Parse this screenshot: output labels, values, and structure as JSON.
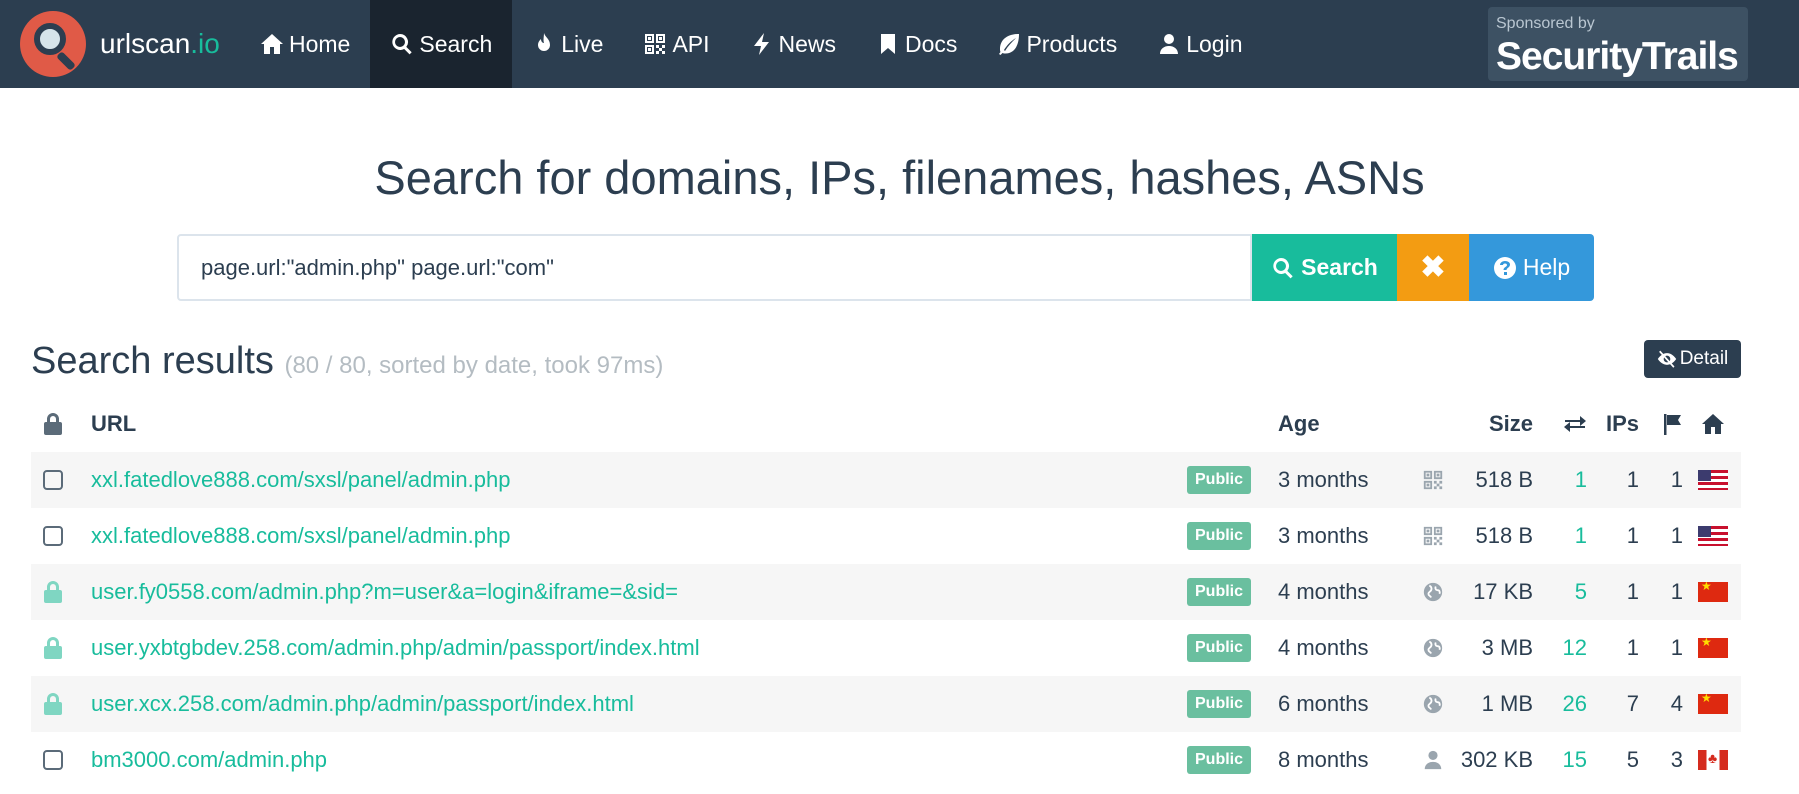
{
  "brand": {
    "name": "urlscan",
    "tld": ".io"
  },
  "nav": {
    "items": [
      {
        "label": "Home",
        "icon": "home-icon"
      },
      {
        "label": "Search",
        "icon": "search-icon",
        "active": true
      },
      {
        "label": "Live",
        "icon": "fire-icon"
      },
      {
        "label": "API",
        "icon": "qrcode-icon"
      },
      {
        "label": "News",
        "icon": "bolt-icon"
      },
      {
        "label": "Docs",
        "icon": "bookmark-icon"
      },
      {
        "label": "Products",
        "icon": "leaf-icon"
      },
      {
        "label": "Login",
        "icon": "user-icon"
      }
    ]
  },
  "sponsor": {
    "small": "Sponsored by",
    "name": "SecurityTrails"
  },
  "headline": "Search for domains, IPs, filenames, hashes, ASNs",
  "search": {
    "value": "page.url:\"admin.php\" page.url:\"com\"",
    "search_label": "Search",
    "clear_label": "✖",
    "help_label": "Help"
  },
  "results": {
    "title": "Search results",
    "meta": "(80 / 80, sorted by date, took 97ms)",
    "detail_label": "Detail"
  },
  "table": {
    "headers": {
      "url": "URL",
      "age": "Age",
      "size": "Size",
      "ips": "IPs"
    },
    "rows": [
      {
        "secure": false,
        "url": "xxl.fatedlove888.com/sxsl/panel/admin.php",
        "visibility": "Public",
        "age": "3 months",
        "source_icon": "qrcode-icon",
        "size": "518 B",
        "requests": "1",
        "ips": "1",
        "countries": "1",
        "flag": "us"
      },
      {
        "secure": false,
        "url": "xxl.fatedlove888.com/sxsl/panel/admin.php",
        "visibility": "Public",
        "age": "3 months",
        "source_icon": "qrcode-icon",
        "size": "518 B",
        "requests": "1",
        "ips": "1",
        "countries": "1",
        "flag": "us"
      },
      {
        "secure": true,
        "url": "user.fy0558.com/admin.php?m=user&a=login&iframe=&sid=",
        "visibility": "Public",
        "age": "4 months",
        "source_icon": "globe-icon",
        "size": "17 KB",
        "requests": "5",
        "ips": "1",
        "countries": "1",
        "flag": "cn"
      },
      {
        "secure": true,
        "url": "user.yxbtgbdev.258.com/admin.php/admin/passport/index.html",
        "visibility": "Public",
        "age": "4 months",
        "source_icon": "globe-icon",
        "size": "3 MB",
        "requests": "12",
        "ips": "1",
        "countries": "1",
        "flag": "cn"
      },
      {
        "secure": true,
        "url": "user.xcx.258.com/admin.php/admin/passport/index.html",
        "visibility": "Public",
        "age": "6 months",
        "source_icon": "globe-icon",
        "size": "1 MB",
        "requests": "26",
        "ips": "7",
        "countries": "4",
        "flag": "cn"
      },
      {
        "secure": false,
        "url": "bm3000.com/admin.php",
        "visibility": "Public",
        "age": "8 months",
        "source_icon": "user-icon",
        "size": "302 KB",
        "requests": "15",
        "ips": "5",
        "countries": "3",
        "flag": "ca"
      }
    ]
  },
  "colors": {
    "navbar": "#2c3e50",
    "accent": "#18bc9c",
    "warning": "#f39c12",
    "info": "#3498db",
    "badge": "#6abf9f"
  }
}
